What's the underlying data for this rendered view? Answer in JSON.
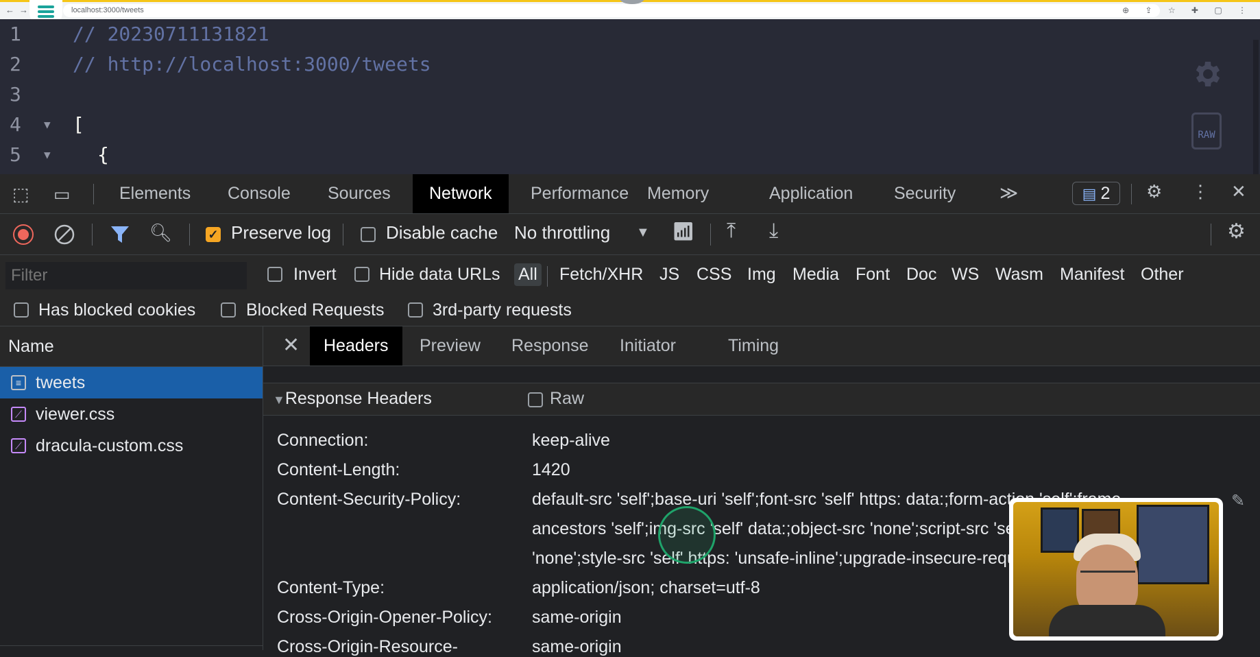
{
  "browser": {
    "url": "localhost:3000/tweets"
  },
  "viewer": {
    "lines": [
      {
        "num": "1",
        "fold": "",
        "text": "// 20230711131821",
        "kind": "cmt",
        "indent": 106
      },
      {
        "num": "2",
        "fold": "",
        "text": "// http://localhost:3000/tweets",
        "kind": "cmt",
        "indent": 106
      },
      {
        "num": "3",
        "fold": "",
        "text": "",
        "kind": "cmt",
        "indent": 106
      },
      {
        "num": "4",
        "fold": "▼",
        "text": "[",
        "kind": "brk",
        "indent": 106
      },
      {
        "num": "5",
        "fold": "▼",
        "text": "{",
        "kind": "brk",
        "indent": 142
      }
    ],
    "raw_label": "RAW"
  },
  "devtools": {
    "tabs": [
      "Elements",
      "Console",
      "Sources",
      "Network",
      "Performance",
      "Memory",
      "Application",
      "Security"
    ],
    "active_tab": "Network",
    "more": "≫",
    "issues_count": "2",
    "toolbar": {
      "preserve_log": "Preserve log",
      "disable_cache": "Disable cache",
      "throttling": "No throttling"
    },
    "filter": {
      "placeholder": "Filter",
      "invert": "Invert",
      "hide_data_urls": "Hide data URLs",
      "types": [
        "All",
        "Fetch/XHR",
        "JS",
        "CSS",
        "Img",
        "Media",
        "Font",
        "Doc",
        "WS",
        "Wasm",
        "Manifest",
        "Other"
      ],
      "has_blocked_cookies": "Has blocked cookies",
      "blocked_requests": "Blocked Requests",
      "third_party": "3rd-party requests"
    },
    "name_header": "Name",
    "requests": [
      "tweets",
      "viewer.css",
      "dracula-custom.css"
    ],
    "detail_tabs": [
      "Headers",
      "Preview",
      "Response",
      "Initiator",
      "Timing"
    ],
    "response_headers_title": "Response Headers",
    "raw_label": "Raw",
    "headers": [
      {
        "name": "Connection:",
        "value": "keep-alive"
      },
      {
        "name": "Content-Length:",
        "value": "1420"
      },
      {
        "name": "Content-Security-Policy:",
        "value": "default-src 'self';base-uri 'self';font-src 'self' https: data:;form-action 'self';frame-"
      },
      {
        "name": "",
        "value": "ancestors 'self';img-src 'self' data:;object-src 'none';script-src 'self';script-src-attr"
      },
      {
        "name": "",
        "value": "'none';style-src 'self' https: 'unsafe-inline';upgrade-insecure-requests"
      },
      {
        "name": "Content-Type:",
        "value": "application/json; charset=utf-8"
      },
      {
        "name": "Cross-Origin-Opener-Policy:",
        "value": "same-origin"
      },
      {
        "name": "Cross-Origin-Resource-",
        "value": "same-origin"
      }
    ]
  }
}
